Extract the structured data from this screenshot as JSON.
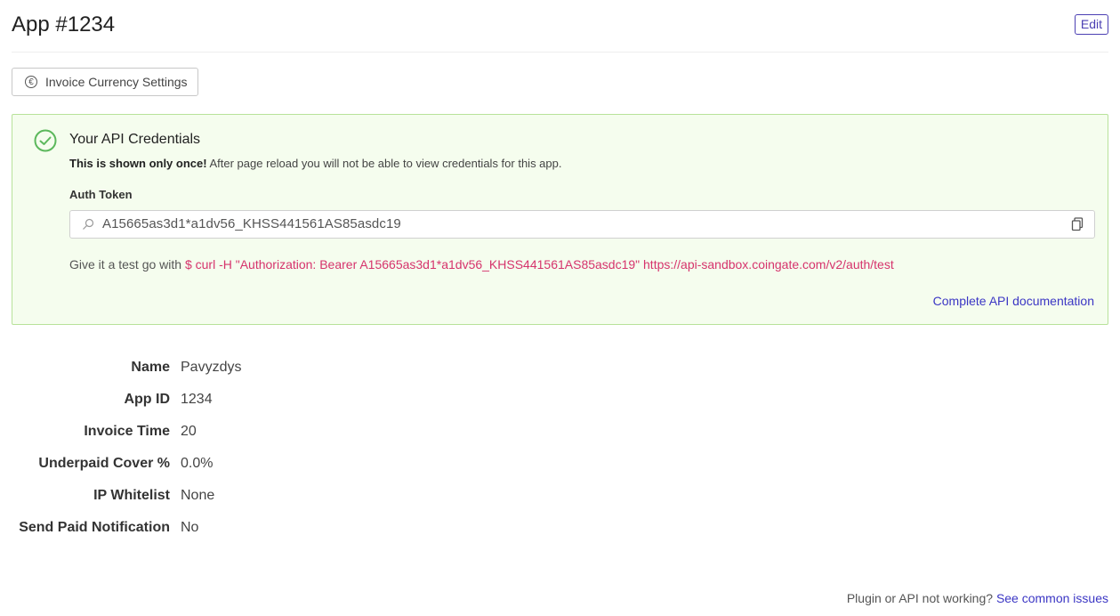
{
  "header": {
    "title": "App #1234",
    "edit_label": "Edit"
  },
  "currency_button": {
    "label": "Invoice Currency Settings",
    "icon": "euro-circle-icon"
  },
  "credentials": {
    "title": "Your API Credentials",
    "warning_bold": "This is shown only once!",
    "warning_rest": " After page reload you will not be able to view credentials for this app.",
    "auth_label": "Auth Token",
    "token": "A15665as3d1*a1dv56_KHSS441561AS85asdc19",
    "test_prefix": "Give it a test go with ",
    "test_command": "$ curl -H \"Authorization: Bearer A15665as3d1*a1dv56_KHSS441561AS85asdc19\" https://api-sandbox.coingate.com/v2/auth/test",
    "doc_link": "Complete API documentation",
    "accent": "#5cb85c"
  },
  "details": [
    {
      "label": "Name",
      "value": "Pavyzdys"
    },
    {
      "label": "App ID",
      "value": "1234"
    },
    {
      "label": "Invoice Time",
      "value": "20"
    },
    {
      "label": "Underpaid Cover %",
      "value": "0.0%"
    },
    {
      "label": "IP Whitelist",
      "value": "None"
    },
    {
      "label": "Send Paid Notification",
      "value": "No"
    }
  ],
  "footer": {
    "text": "Plugin or API not working? ",
    "link": "See common issues"
  }
}
